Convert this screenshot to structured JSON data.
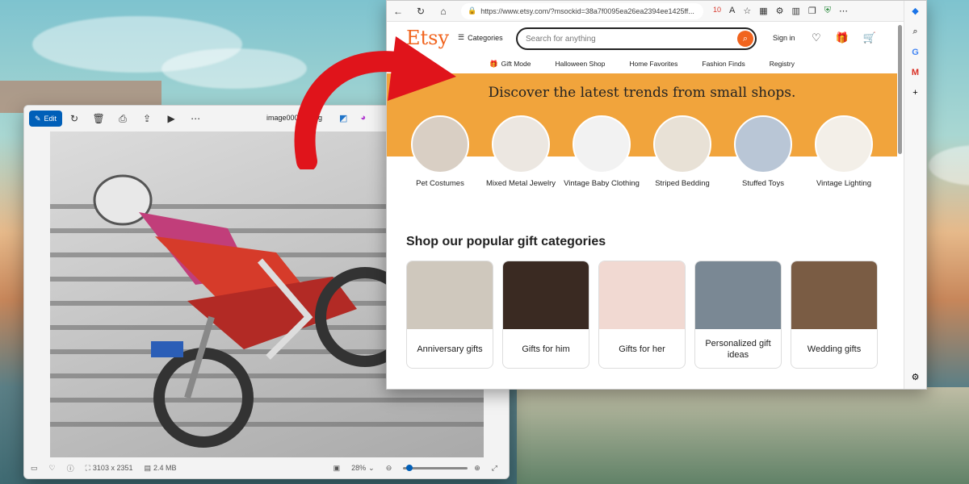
{
  "colors": {
    "etsy_orange": "#f1641e",
    "trends_bg": "#f1a43c",
    "edit_blue": "#005fb8",
    "arrow_red": "#e0141b"
  },
  "viewer": {
    "edit_label": "Edit",
    "filename": "image00002.jpeg",
    "toolbar_icons": [
      "rotate-icon",
      "delete-icon",
      "print-icon",
      "share-icon",
      "slideshow-icon",
      "more-icon"
    ],
    "status": {
      "dimensions": "3103 x 2351",
      "size": "2.4 MB",
      "zoom": "28%"
    }
  },
  "browser": {
    "url": "https://www.etsy.com/?msockid=38a7f0095ea26ea2394ee1425ff...",
    "tab_badge": "10"
  },
  "etsy": {
    "logo": "Etsy",
    "categories_label": "Categories",
    "search_placeholder": "Search for anything",
    "signin_label": "Sign in",
    "subnav": [
      "Gift Mode",
      "Halloween Shop",
      "Home Favorites",
      "Fashion Finds",
      "Registry"
    ],
    "trends_title": "Discover the latest trends from small shops.",
    "trend_items": [
      {
        "label": "Pet Costumes",
        "color": "#d9cfc4"
      },
      {
        "label": "Mixed Metal Jewelry",
        "color": "#ece7e1"
      },
      {
        "label": "Vintage Baby Clothing",
        "color": "#f2f2f2"
      },
      {
        "label": "Striped Bedding",
        "color": "#e8e1d6"
      },
      {
        "label": "Stuffed Toys",
        "color": "#b9c6d6"
      },
      {
        "label": "Vintage Lighting",
        "color": "#f3efe8"
      }
    ],
    "gifts_title": "Shop our popular gift categories",
    "gift_items": [
      {
        "label": "Anniversary gifts",
        "color": "#cfc8bd"
      },
      {
        "label": "Gifts for him",
        "color": "#3a2a22"
      },
      {
        "label": "Gifts for her",
        "color": "#f1d9d2"
      },
      {
        "label": "Personalized gift ideas",
        "color": "#7a8894"
      },
      {
        "label": "Wedding gifts",
        "color": "#7a5c44"
      }
    ]
  }
}
